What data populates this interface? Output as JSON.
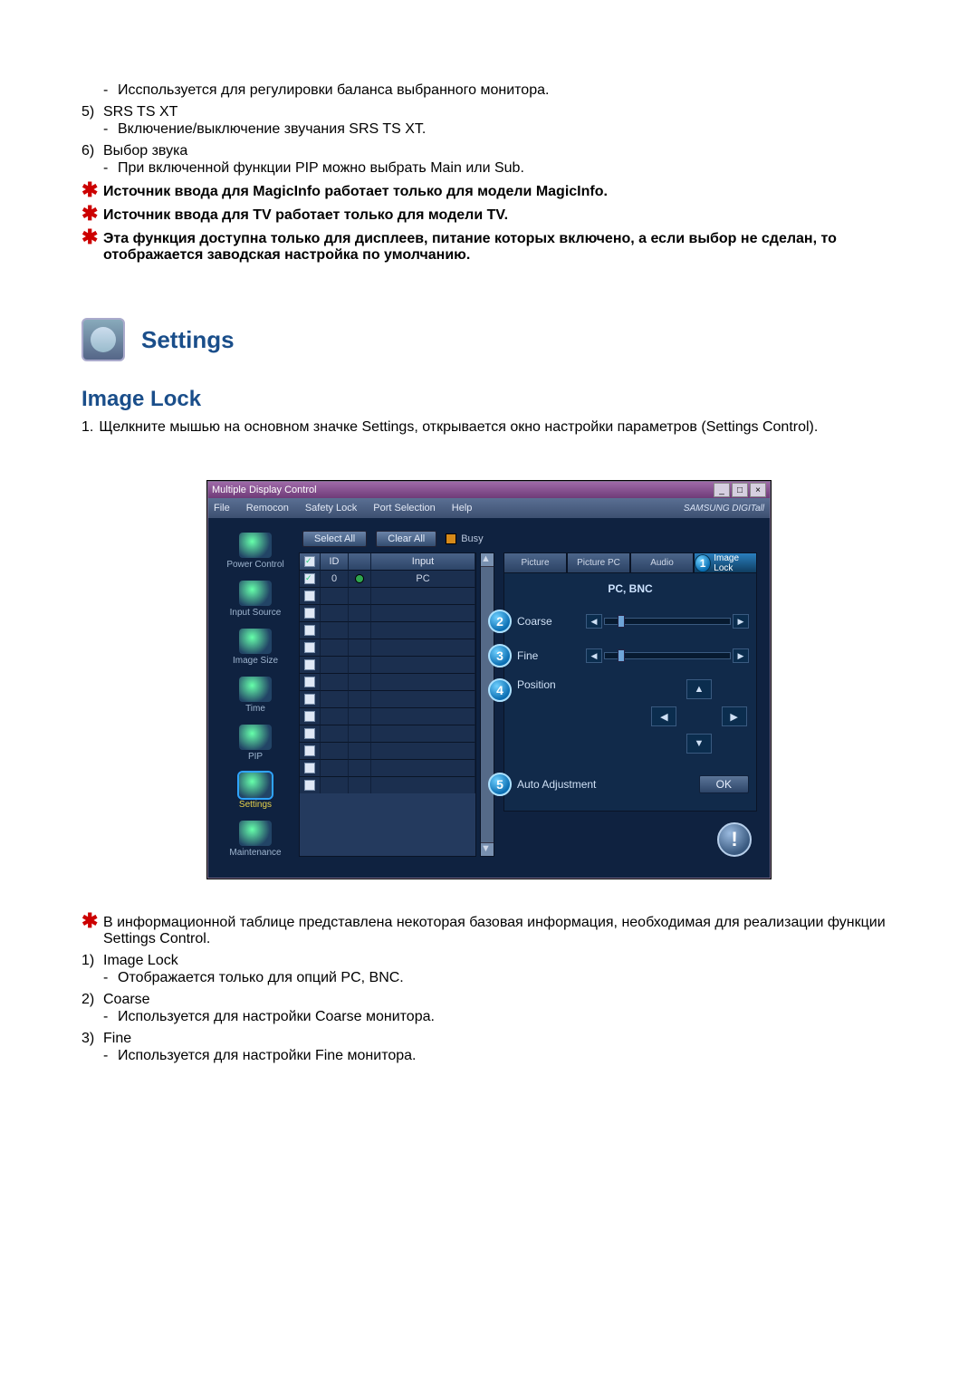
{
  "pre_notes": {
    "balance_desc": "Исспользуется для регулировки баланса выбранного монитора.",
    "item5_num": "5)",
    "item5_title": "SRS TS XT",
    "item5_desc": "Включение/выключение звучания SRS TS XT.",
    "item6_num": "6)",
    "item6_title": "Выбор звука",
    "item6_desc": "При включенной функции PIP можно выбрать Main или Sub.",
    "star1": "Источник ввода для MagicInfo работает только для модели MagicInfo.",
    "star2": "Источник ввода для TV работает только для модели TV.",
    "star3": "Эта функция доступна только для дисплеев, питание которых включено, а если выбор не сделан, то отображается заводская настройка по умолчанию."
  },
  "section_title": "Settings",
  "subhead": "Image Lock",
  "step1_num": "1.",
  "step1_text": "Щелкните мышью на основном значке Settings, открывается окно настройки параметров (Settings Control).",
  "shot": {
    "title": "Multiple Display Control",
    "menu": [
      "File",
      "Remocon",
      "Safety Lock",
      "Port Selection",
      "Help"
    ],
    "brand": "SAMSUNG DIGITall",
    "sidebar": [
      "Power Control",
      "Input Source",
      "Image Size",
      "Time",
      "PIP",
      "Settings",
      "Maintenance"
    ],
    "sidebar_selected_index": 5,
    "select_all": "Select All",
    "clear_all": "Clear All",
    "busy": "Busy",
    "columns": {
      "id": "ID",
      "input": "Input"
    },
    "row": {
      "id": "0",
      "input": "PC"
    },
    "tabs": [
      "Picture",
      "Picture PC",
      "Audio",
      "Image Lock"
    ],
    "tabs_selected_index": 3,
    "tab_badge": "1",
    "panel_head": "PC, BNC",
    "coarse_num": "2",
    "coarse_label": "Coarse",
    "fine_num": "3",
    "fine_label": "Fine",
    "position_num": "4",
    "position_label": "Position",
    "auto_num": "5",
    "auto_label": "Auto Adjustment",
    "ok": "OK"
  },
  "post_notes": {
    "star1": "В информационной таблице представлена некоторая базовая информация, необходимая для реализации функции Settings Control.",
    "i1_num": "1)",
    "i1_title": "Image Lock",
    "i1_desc": "Отображается только для опций PC, BNC.",
    "i2_num": "2)",
    "i2_title": "Coarse",
    "i2_desc": "Используется для настройки Coarse монитора.",
    "i3_num": "3)",
    "i3_title": "Fine",
    "i3_desc": "Используется для настройки Fine монитора."
  }
}
